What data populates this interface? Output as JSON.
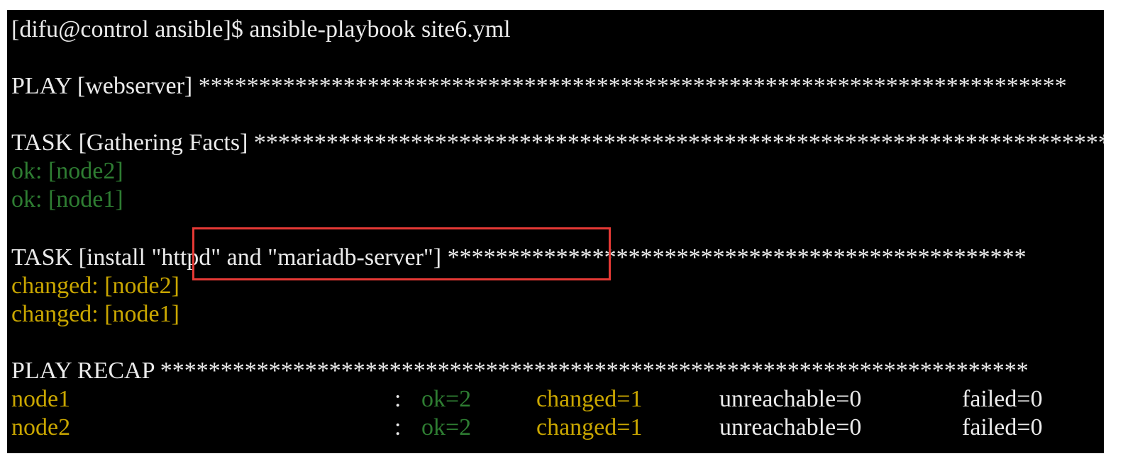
{
  "terminal": {
    "partial_top": "[            ]    ",
    "prompt": "[difu@control ansible]$ ansible-playbook site6.yml",
    "play_header": "PLAY [webserver] ************************************************************************",
    "task1_header": "TASK [Gathering Facts] ************************************************************************",
    "task1_results": [
      "ok: [node2]",
      "ok: [node1]"
    ],
    "task2_header": "TASK [install \"httpd\" and \"mariadb-server\"] ************************************************",
    "task2_results": [
      "changed: [node2]",
      "changed: [node1]"
    ],
    "recap_header": "PLAY RECAP ************************************************************************",
    "recap_rows": [
      {
        "host": "node1",
        "sep": ":",
        "ok": "ok=2",
        "changed": "changed=1",
        "unreachable": "unreachable=0",
        "failed": "failed=0"
      },
      {
        "host": "node2",
        "sep": ":",
        "ok": "ok=2",
        "changed": "changed=1",
        "unreachable": "unreachable=0",
        "failed": "failed=0"
      }
    ]
  },
  "colors": {
    "background": "#000000",
    "text": "#ebebeb",
    "ok": "#2e7d32",
    "changed": "#c9a600",
    "highlight_box": "#e53935"
  }
}
